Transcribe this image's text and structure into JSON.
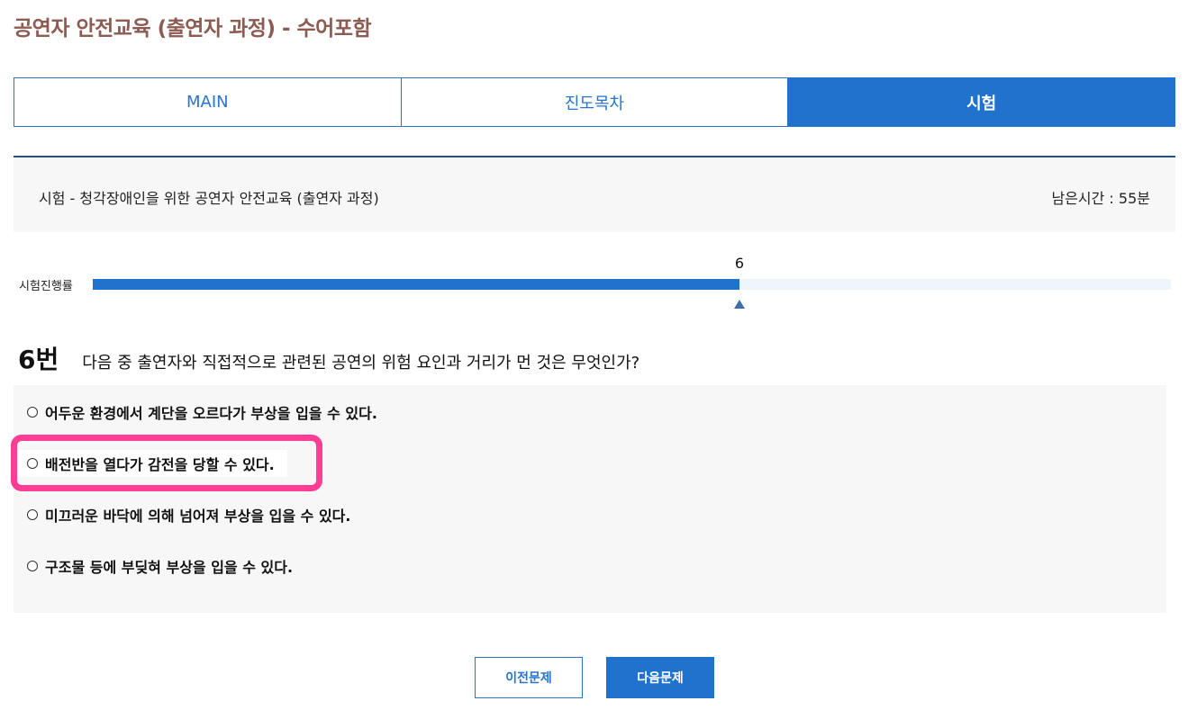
{
  "page": {
    "title": "공연자 안전교육 (출연자 과정) - 수어포함"
  },
  "tabs": [
    {
      "label": "MAIN",
      "active": false
    },
    {
      "label": "진도목차",
      "active": false
    },
    {
      "label": "시험",
      "active": true
    }
  ],
  "exam": {
    "title": "시험 - 청각장애인을 위한 공연자 안전교육 (출연자 과정)",
    "remaining_time": "남은시간 : 55분"
  },
  "progress": {
    "label": "시험진행률",
    "current_text": "6",
    "fraction": 0.6
  },
  "question": {
    "number": "6번",
    "text": "다음 중 출연자와 직접적으로 관련된 공연의 위험 요인과 거리가 먼 것은 무엇인가?",
    "options": [
      "어두운 환경에서 계단을 오르다가 부상을 입을 수 있다.",
      "배전반을 열다가 감전을 당할 수 있다.",
      "미끄러운 바닥에 의해 넘어져 부상을 입을 수 있다.",
      "구조물 등에 부딪혀 부상을 입을 수 있다."
    ],
    "highlighted_option": 1
  },
  "buttons": {
    "prev": "이전문제",
    "next": "다음문제"
  },
  "colors": {
    "accent": "#2072cd",
    "title": "#8c5b52",
    "highlight": "#ff3d94",
    "progress_track": "#eef6fb"
  }
}
